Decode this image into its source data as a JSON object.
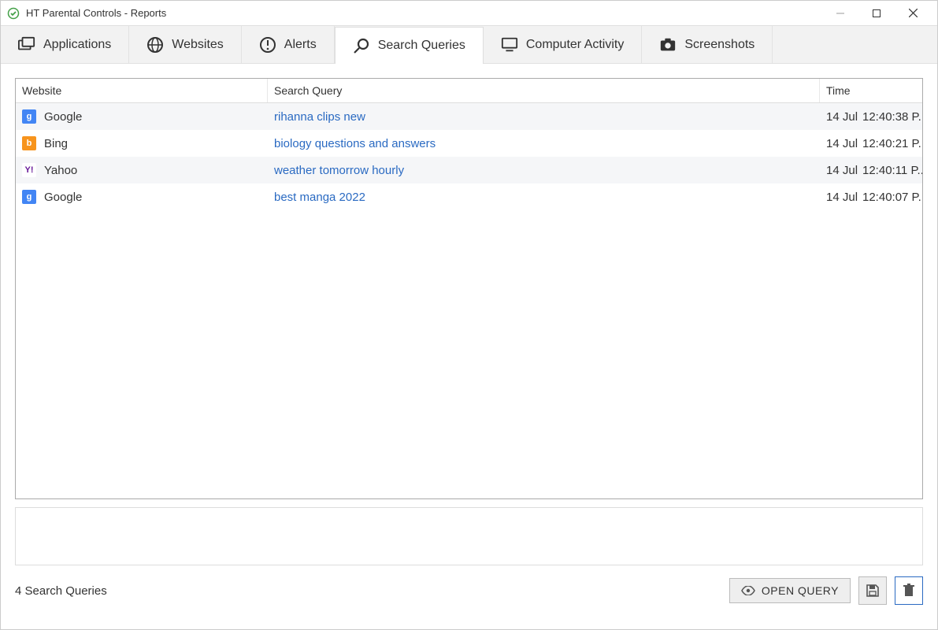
{
  "window": {
    "title": "HT Parental Controls - Reports"
  },
  "tabs": [
    {
      "label": "Applications",
      "icon": "applications-icon",
      "active": false
    },
    {
      "label": "Websites",
      "icon": "globe-icon",
      "active": false
    },
    {
      "label": "Alerts",
      "icon": "alert-icon",
      "active": false
    },
    {
      "label": "Search Queries",
      "icon": "search-icon",
      "active": true
    },
    {
      "label": "Computer Activity",
      "icon": "monitor-icon",
      "active": false
    },
    {
      "label": "Screenshots",
      "icon": "camera-icon",
      "active": false
    }
  ],
  "grid": {
    "columns": {
      "website": "Website",
      "query": "Search Query",
      "time": "Time"
    },
    "rows": [
      {
        "site": "Google",
        "favicon": "google",
        "query": "rihanna clips new",
        "date": "14 Jul",
        "time": "12:40:38 P..."
      },
      {
        "site": "Bing",
        "favicon": "bing",
        "query": "biology questions and answers",
        "date": "14 Jul",
        "time": "12:40:21 P..."
      },
      {
        "site": "Yahoo",
        "favicon": "yahoo",
        "query": "weather tomorrow hourly",
        "date": "14 Jul",
        "time": "12:40:11 P..."
      },
      {
        "site": "Google",
        "favicon": "google",
        "query": "best manga 2022",
        "date": "14 Jul",
        "time": "12:40:07 P..."
      }
    ]
  },
  "footer": {
    "status": "4 Search Queries",
    "open_query_label": "OPEN QUERY"
  },
  "favicon_style": {
    "google": {
      "bg": "#4285f4",
      "text": "g"
    },
    "bing": {
      "bg": "#f7941d",
      "text": "b"
    },
    "yahoo": {
      "bg": "#ffffff",
      "text": "Y!",
      "fg": "#6a1b9a"
    }
  }
}
